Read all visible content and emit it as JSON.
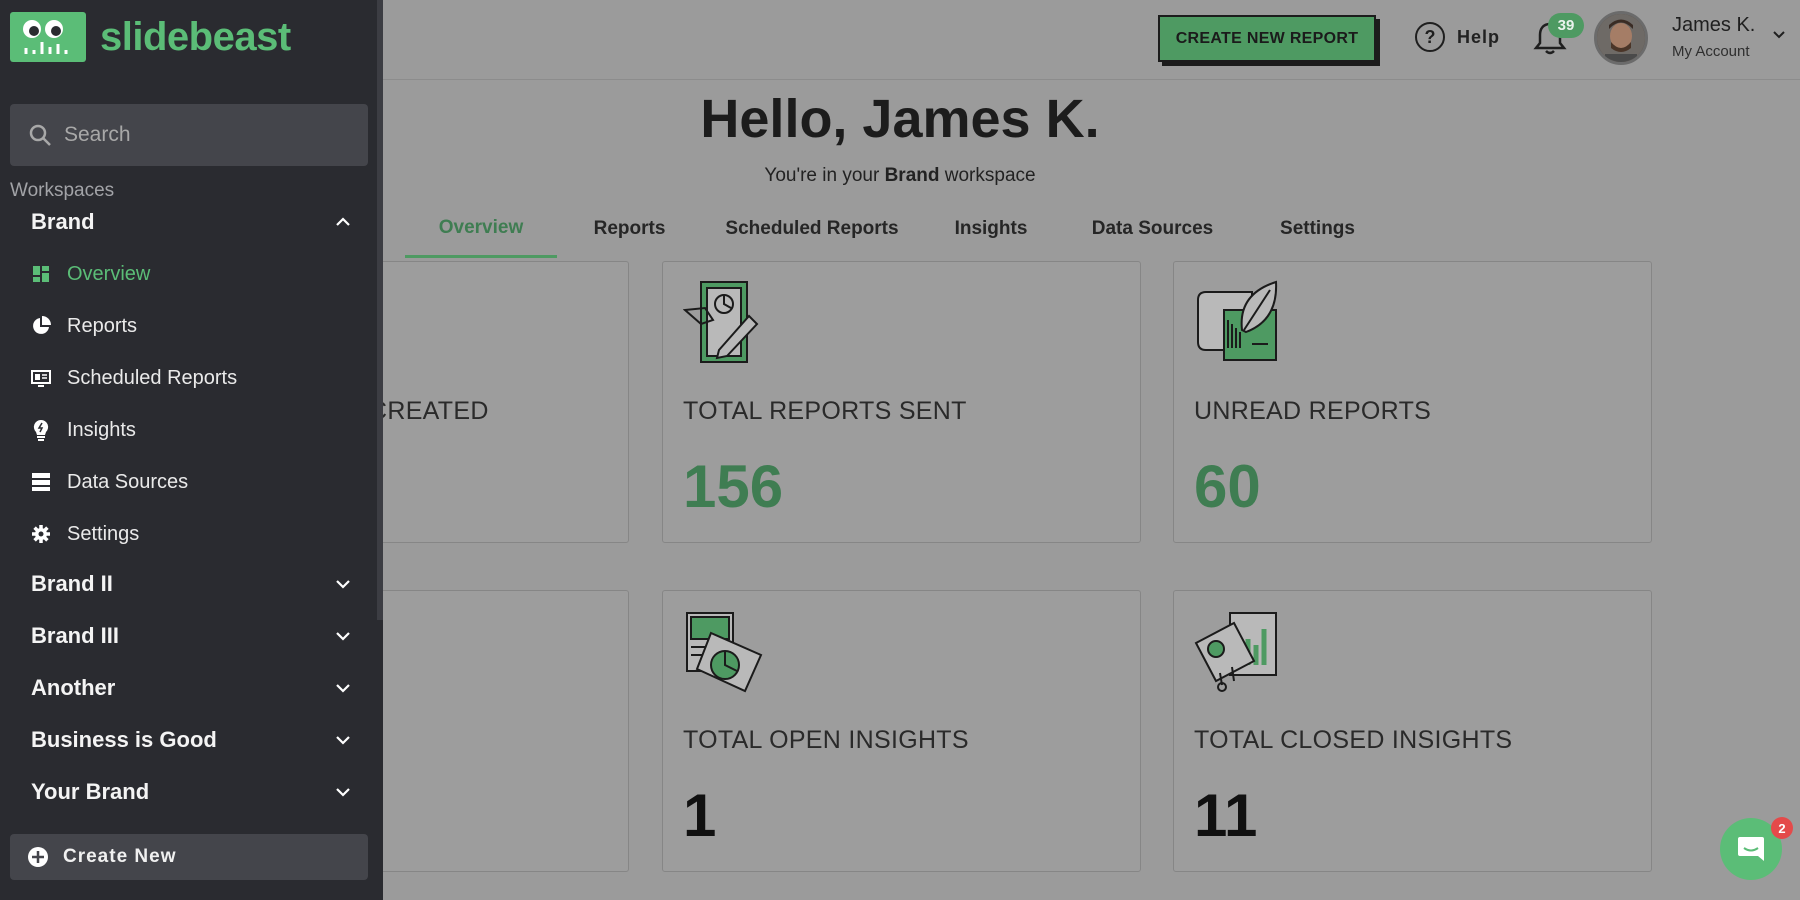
{
  "header": {
    "create_report_label": "CREATE NEW REPORT",
    "help_label": "Help",
    "notifications_count": "39",
    "account_name": "James K.",
    "account_sub": "My Account"
  },
  "welcome": {
    "title": "Hello, James K.",
    "workspace_prefix": "You're in your ",
    "workspace_name": "Brand",
    "workspace_suffix": " workspace"
  },
  "tabs": [
    {
      "label": "Overview",
      "active": true
    },
    {
      "label": "Reports"
    },
    {
      "label": "Scheduled Reports"
    },
    {
      "label": "Insights"
    },
    {
      "label": "Data Sources"
    },
    {
      "label": "Settings"
    }
  ],
  "cards": [
    {
      "label": "CREATED",
      "value": ""
    },
    {
      "label": "TOTAL REPORTS SENT",
      "value": "156"
    },
    {
      "label": "UNREAD REPORTS",
      "value": "60"
    },
    {
      "label": "",
      "value": ""
    },
    {
      "label": "TOTAL OPEN INSIGHTS",
      "value": "1"
    },
    {
      "label": "TOTAL CLOSED INSIGHTS",
      "value": "11"
    }
  ],
  "sidebar": {
    "brand_name": "slidebeast",
    "search_placeholder": "Search",
    "workspaces_heading": "Workspaces",
    "workspaces": [
      {
        "label": "Brand",
        "expanded": true
      },
      {
        "label": "Brand II"
      },
      {
        "label": "Brand III"
      },
      {
        "label": "Another"
      },
      {
        "label": "Business is Good"
      },
      {
        "label": "Your Brand"
      }
    ],
    "sub_items": [
      {
        "label": "Overview",
        "icon": "dashboard-icon",
        "active": true
      },
      {
        "label": "Reports",
        "icon": "pie-chart-icon"
      },
      {
        "label": "Scheduled Reports",
        "icon": "scheduled-monitor-icon"
      },
      {
        "label": "Insights",
        "icon": "lightbulb-icon"
      },
      {
        "label": "Data Sources",
        "icon": "server-icon"
      },
      {
        "label": "Settings",
        "icon": "gear-icon"
      }
    ],
    "create_new_label": "Create New"
  },
  "chat": {
    "badge": "2"
  },
  "colors": {
    "accent": "#5bbd77",
    "accent_dimmed": "#4e9a62",
    "sidebar_bg": "#2a2b30",
    "overlay_bg": "#9b9b9b"
  }
}
